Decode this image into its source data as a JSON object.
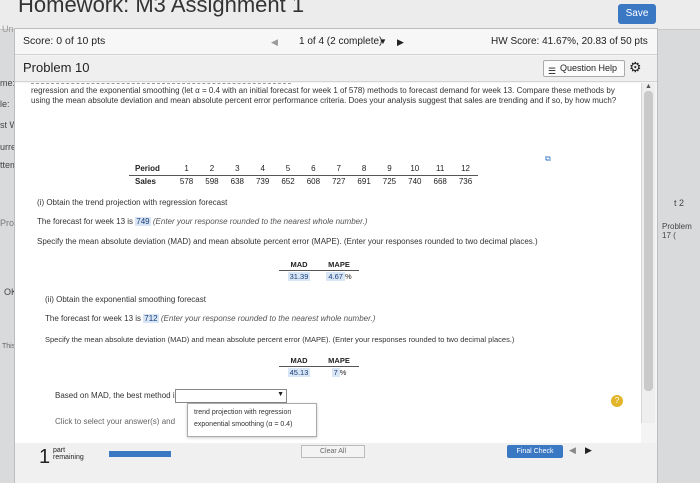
{
  "window": {
    "title": "Homework: M3 Assignment 1",
    "save_label": "Save"
  },
  "background_fragments": {
    "un": "Un",
    "me": "me:",
    "le": "le:",
    "st": "st W",
    "curren": "urren",
    "attemp": "ttemp",
    "pro": "Pro",
    "ok": "OK",
    "course": "This course",
    "two": "t 2",
    "problem17": "Problem 17 ("
  },
  "score": {
    "label": "Score: 0 of 10 pts"
  },
  "nav": {
    "position": "1 of 4 (2 complete)",
    "prev": "◀",
    "next": "▶",
    "drop": "▼"
  },
  "hw_score": "HW Score: 41.67%, 20.83 of 50 pts",
  "problem": {
    "title": "Problem 10",
    "help_label": "Question Help"
  },
  "intro": "regression and the exponential smoothing (let α = 0.4 with an initial forecast for week 1 of 578) methods to forecast demand for week 13. Compare these methods by using the mean absolute deviation and mean absolute percent error performance criteria. Does your analysis suggest that sales are trending and if so, by how much?",
  "table": {
    "period_label": "Period",
    "sales_label": "Sales",
    "periods": [
      "1",
      "2",
      "3",
      "4",
      "5",
      "6",
      "7",
      "8",
      "9",
      "10",
      "11",
      "12"
    ],
    "sales": [
      "578",
      "598",
      "638",
      "739",
      "652",
      "608",
      "727",
      "691",
      "725",
      "740",
      "668",
      "736"
    ]
  },
  "part_i": {
    "heading": "(i) Obtain the trend projection with regression forecast",
    "forecast_prefix": "The forecast for week 13 is",
    "forecast_value": "749",
    "forecast_hint": "(Enter your response rounded to the nearest whole number.)",
    "error_prompt": "Specify the mean absolute deviation (MAD) and mean absolute percent error (MAPE). (Enter your responses rounded to two decimal places.)",
    "mad_label": "MAD",
    "mape_label": "MAPE",
    "mad_value": "31.39",
    "mape_value": "4.67",
    "percent": "%"
  },
  "part_ii": {
    "heading": "(ii) Obtain the exponential smoothing forecast",
    "forecast_prefix": "The forecast for week 13 is",
    "forecast_value": "712",
    "forecast_hint": "(Enter your response rounded to the nearest whole number.)",
    "error_prompt": "Specify the mean absolute deviation (MAD) and mean absolute percent error (MAPE). (Enter your responses rounded to two decimal places.)",
    "mad_label": "MAD",
    "mape_label": "MAPE",
    "mad_value": "45.13",
    "mape_value": "7",
    "percent": "%"
  },
  "best_method": {
    "prompt": "Based on MAD, the best method is",
    "options": [
      "trend projection with regression",
      "exponential smoothing (α = 0.4)"
    ]
  },
  "footer": {
    "click_hint": "Click to select your answer(s) and",
    "part_count": "1",
    "part_label_1": "part",
    "part_label_2": "remaining",
    "progress": 0.35,
    "clear_all": "Clear All",
    "final_check": "Final Check",
    "prev": "◀",
    "next": "▶",
    "help": "?"
  }
}
